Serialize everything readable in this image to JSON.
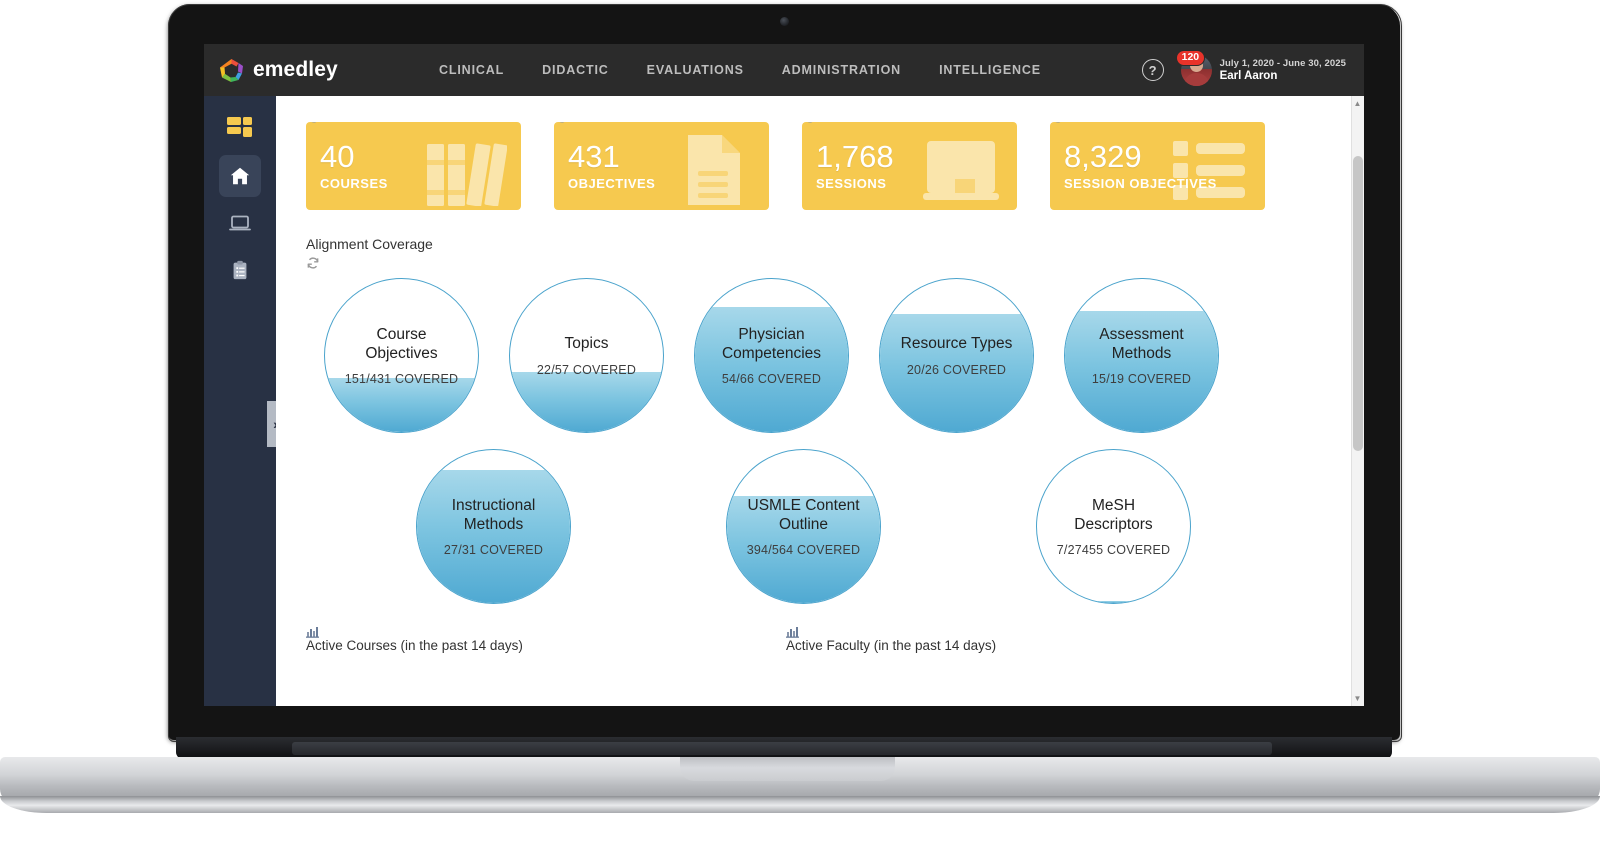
{
  "header": {
    "brand_name": "emedley",
    "brand_logo_icon": "emedley-hexagon-logo",
    "nav_items": [
      {
        "label": "CLINICAL"
      },
      {
        "label": "DIDACTIC"
      },
      {
        "label": "EVALUATIONS"
      },
      {
        "label": "ADMINISTRATION"
      },
      {
        "label": "INTELLIGENCE"
      }
    ],
    "help_icon": "question-mark-icon",
    "help_glyph": "?",
    "notification_count": "120",
    "date_range": "July 1, 2020 - June 30, 2025",
    "user_name": "Earl Aaron",
    "background_color": "#2b2b2b"
  },
  "sidebar": {
    "items": [
      {
        "name": "dashboard-blocks",
        "icon": "grid-blocks-icon",
        "active": false
      },
      {
        "name": "home",
        "icon": "home-icon",
        "active": true
      },
      {
        "name": "screen",
        "icon": "laptop-screen-icon",
        "active": false
      },
      {
        "name": "clipboard",
        "icon": "clipboard-list-icon",
        "active": false
      }
    ],
    "toggle_glyph": "»",
    "background_color": "#283144"
  },
  "stat_cards": [
    {
      "value": "40",
      "label": "COURSES",
      "icon": "books-icon"
    },
    {
      "value": "431",
      "label": "OBJECTIVES",
      "icon": "document-icon"
    },
    {
      "value": "1,768",
      "label": "SESSIONS",
      "icon": "whiteboard-icon"
    },
    {
      "value": "8,329",
      "label": "SESSION OBJECTIVES",
      "icon": "list-icon"
    }
  ],
  "stat_card_color": "#f6c94f",
  "coverage": {
    "title": "Alignment Coverage",
    "refresh_icon": "refresh-icon",
    "accent_color": "#4aa3cc",
    "row1": [
      {
        "name": "Course Objectives",
        "coverage": "151/431 COVERED",
        "percent": 35
      },
      {
        "name": "Topics",
        "coverage": "22/57 COVERED",
        "percent": 39
      },
      {
        "name": "Physician Competencies",
        "coverage": "54/66 COVERED",
        "percent": 82
      },
      {
        "name": "Resource Types",
        "coverage": "20/26 COVERED",
        "percent": 77
      },
      {
        "name": "Assessment Methods",
        "coverage": "15/19 COVERED",
        "percent": 79
      }
    ],
    "row2": [
      {
        "name": "Instructional Methods",
        "coverage": "27/31 COVERED",
        "percent": 87
      },
      {
        "name": "USMLE Content Outline",
        "coverage": "394/564 COVERED",
        "percent": 70
      },
      {
        "name": "MeSH Descriptors",
        "coverage": "7/27455 COVERED",
        "percent": 1
      }
    ]
  },
  "bottom_panels": [
    {
      "title": "Active Courses (in the past 14 days)",
      "icon": "bar-chart-icon"
    },
    {
      "title": "Active Faculty (in the past 14 days)",
      "icon": "bar-chart-icon"
    }
  ]
}
